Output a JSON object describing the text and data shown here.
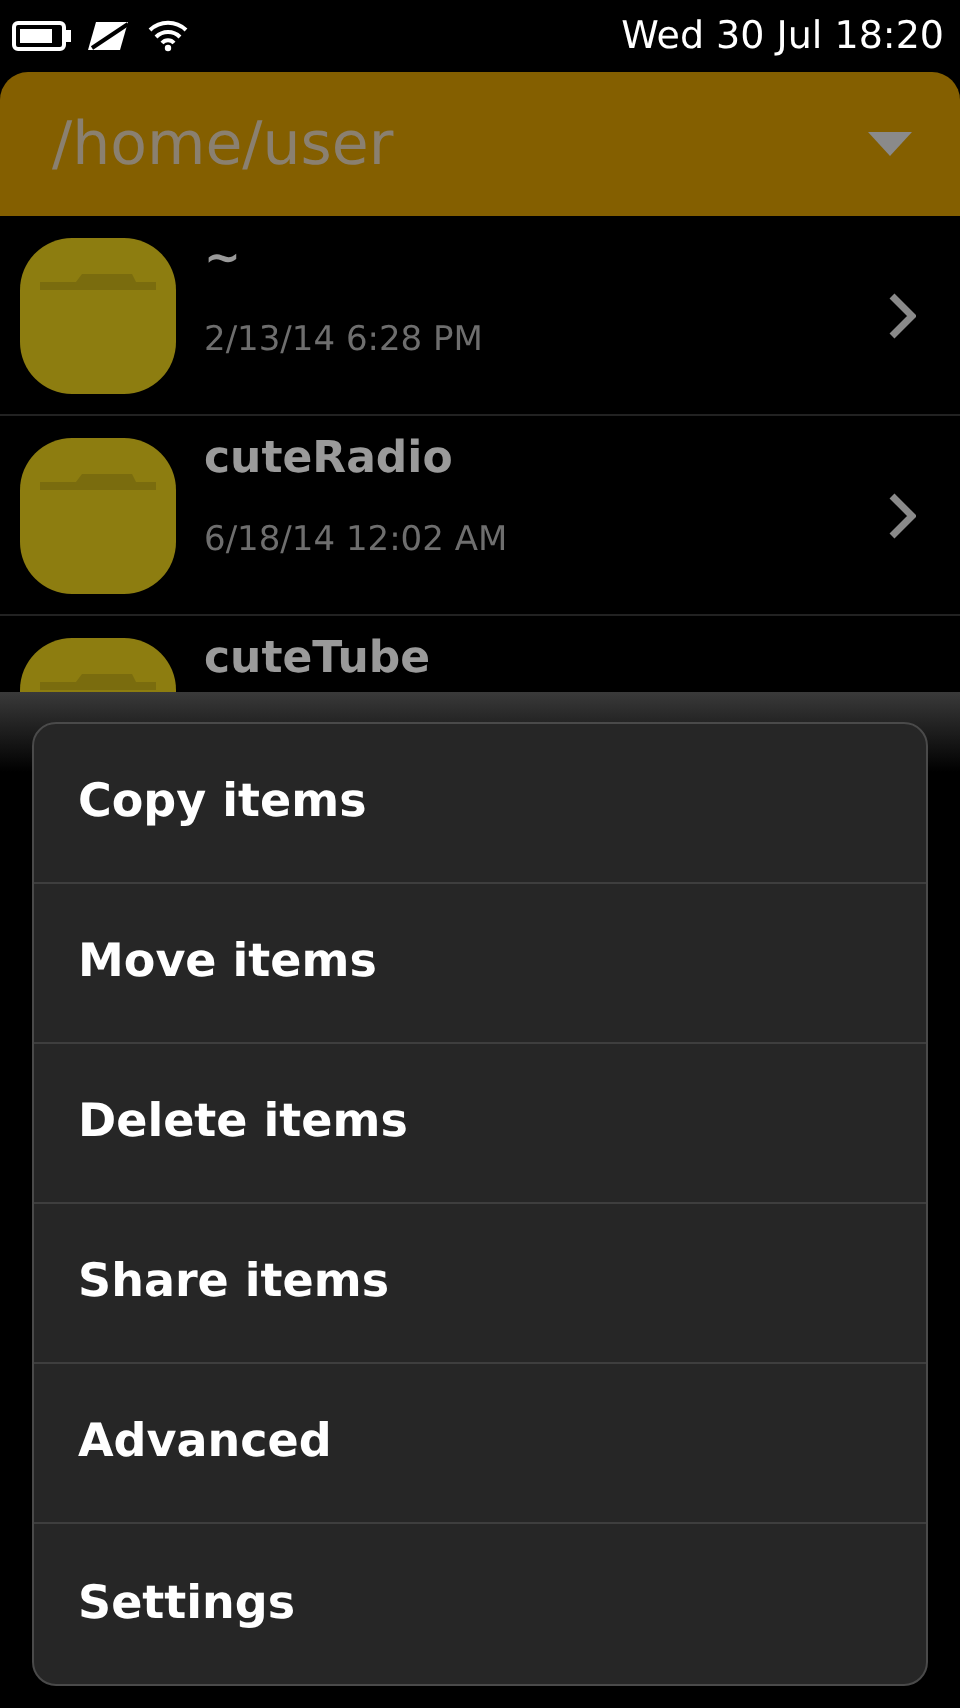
{
  "status_bar": {
    "clock": "Wed 30 Jul 18:20"
  },
  "header": {
    "path": "/home/user"
  },
  "files": [
    {
      "name": "~",
      "modified": "2/13/14 6:28 PM",
      "chevron": true
    },
    {
      "name": "cuteRadio",
      "modified": "6/18/14 12:02 AM",
      "chevron": true
    },
    {
      "name": "cuteTube"
    }
  ],
  "menu": {
    "items": [
      {
        "label": "Copy items"
      },
      {
        "label": "Move items"
      },
      {
        "label": "Delete items"
      },
      {
        "label": "Share items"
      },
      {
        "label": "Advanced"
      },
      {
        "label": "Settings"
      }
    ]
  }
}
